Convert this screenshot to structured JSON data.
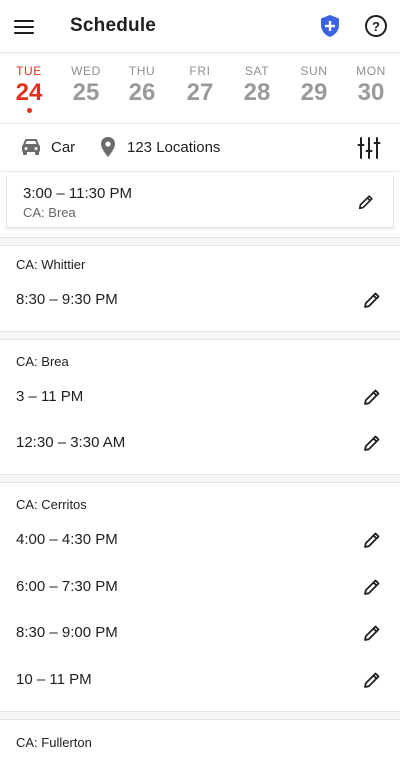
{
  "header": {
    "title": "Schedule",
    "menu_icon": "hamburger-menu-icon",
    "shield_icon": "shield-plus-icon",
    "help_icon": "question-icon",
    "help_glyph": "?"
  },
  "week": [
    {
      "dow": "TUE",
      "num": "24",
      "selected": true
    },
    {
      "dow": "WED",
      "num": "25"
    },
    {
      "dow": "THU",
      "num": "26"
    },
    {
      "dow": "FRI",
      "num": "27"
    },
    {
      "dow": "SAT",
      "num": "28"
    },
    {
      "dow": "SUN",
      "num": "29"
    },
    {
      "dow": "MON",
      "num": "30"
    }
  ],
  "filters": {
    "vehicle": "Car",
    "locations": "123 Locations"
  },
  "current_shift": {
    "time": "3:00 – 11:30 PM",
    "location": "CA: Brea"
  },
  "groups": [
    {
      "title": "CA: Whittier",
      "slots": [
        "8:30 – 9:30 PM"
      ]
    },
    {
      "title": "CA: Brea",
      "slots": [
        "3 – 11 PM",
        "12:30 – 3:30 AM"
      ]
    },
    {
      "title": "CA: Cerritos",
      "slots": [
        "4:00 – 4:30 PM",
        "6:00 – 7:30 PM",
        "8:30 – 9:00 PM",
        "10 – 11 PM"
      ]
    },
    {
      "title": "CA: Fullerton",
      "slots": []
    }
  ],
  "colors": {
    "accent": "#e0321e",
    "shield": "#3a63e0"
  }
}
